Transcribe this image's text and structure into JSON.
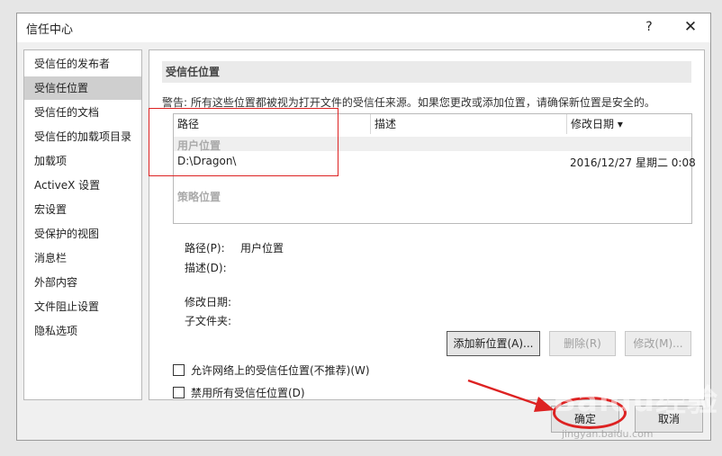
{
  "window": {
    "title": "信任中心",
    "help_glyph": "?",
    "close_glyph": "✕"
  },
  "sidebar": {
    "items": [
      {
        "label": "受信任的发布者"
      },
      {
        "label": "受信任位置",
        "active": true
      },
      {
        "label": "受信任的文档"
      },
      {
        "label": "受信任的加载项目录"
      },
      {
        "label": "加载项"
      },
      {
        "label": "ActiveX 设置"
      },
      {
        "label": "宏设置"
      },
      {
        "label": "受保护的视图"
      },
      {
        "label": "消息栏"
      },
      {
        "label": "外部内容"
      },
      {
        "label": "文件阻止设置"
      },
      {
        "label": "隐私选项"
      }
    ]
  },
  "panel": {
    "section_title": "受信任位置",
    "warning": "警告: 所有这些位置都被视为打开文件的受信任来源。如果您更改或添加位置，请确保新位置是安全的。",
    "table": {
      "columns": [
        "路径",
        "描述",
        "修改日期 ▾"
      ],
      "groups": {
        "user": "用户位置",
        "policy": "策略位置"
      },
      "rows": [
        {
          "path": "D:\\Dragon\\",
          "description": "",
          "modified": "2016/12/27 星期二 0:08"
        }
      ]
    },
    "details": {
      "path_label": "路径(P):",
      "path_value": "用户位置",
      "desc_label": "描述(D):",
      "modified_label": "修改日期:",
      "subfolder_label": "子文件夹:"
    },
    "buttons": {
      "add": "添加新位置(A)...",
      "remove": "删除(R)",
      "modify": "修改(M)..."
    },
    "checkboxes": {
      "allow_network": "允许网络上的受信任位置(不推荐)(W)",
      "disable_all": "禁用所有受信任位置(D)"
    }
  },
  "footer": {
    "ok": "确定",
    "cancel": "取消"
  },
  "watermark": {
    "logo": "Baidu经验",
    "url": "jingyan.baidu.com"
  },
  "colors": {
    "annotation_red": "#d22222"
  }
}
